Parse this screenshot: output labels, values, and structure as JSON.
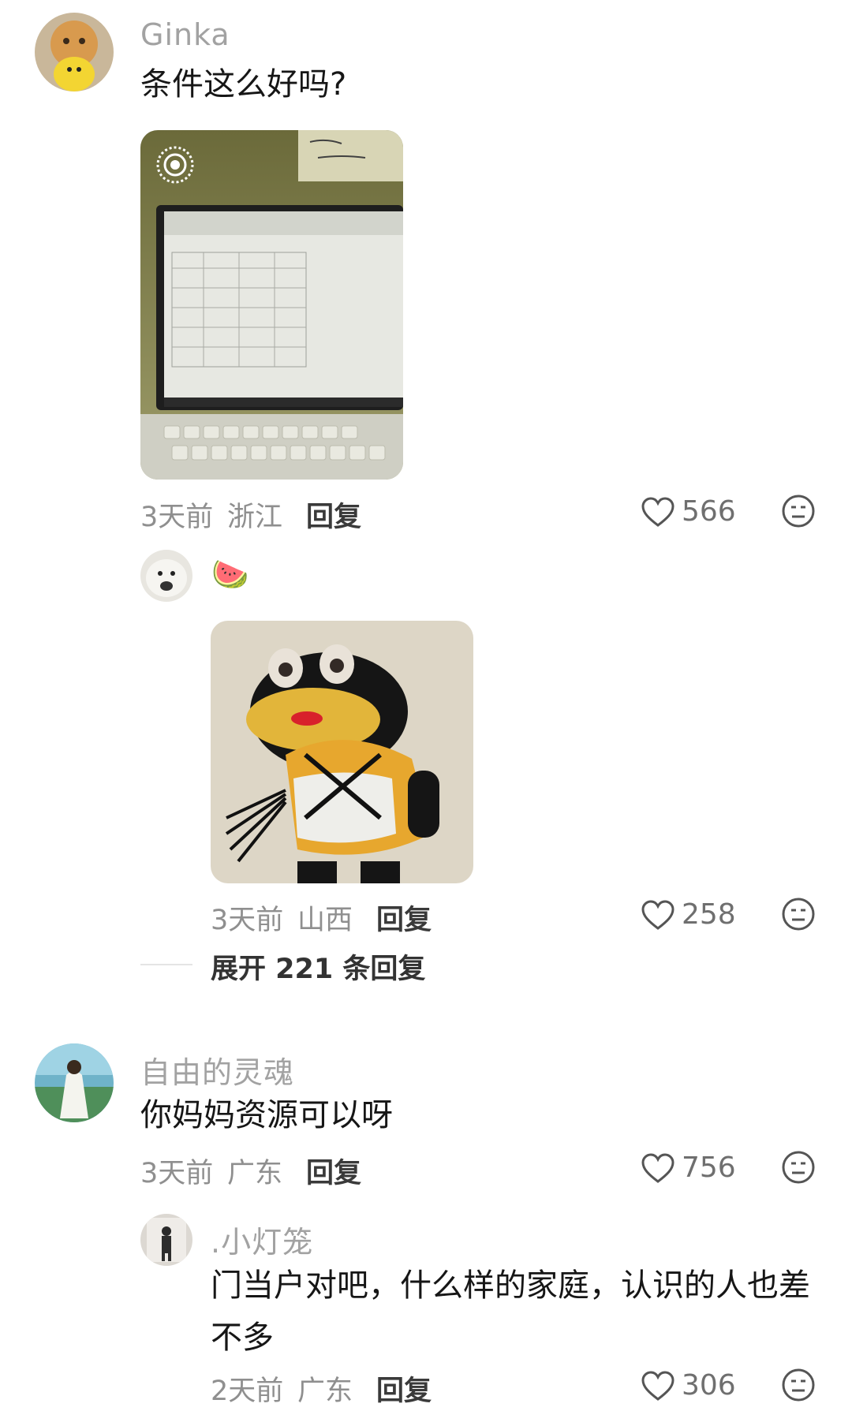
{
  "comments": [
    {
      "username": "Ginka",
      "text": "条件这么好吗?",
      "time": "3天前",
      "location": "浙江",
      "reply_label": "回复",
      "likes": "566",
      "image": "laptop-spreadsheet-photo",
      "sub_replies": [
        {
          "emoji": "🍉",
          "image": "duck-costume-meme",
          "time": "3天前",
          "location": "山西",
          "reply_label": "回复",
          "likes": "258"
        }
      ],
      "expand_label": "展开 221 条回复"
    },
    {
      "username": "自由的灵魂",
      "text": "你妈妈资源可以呀",
      "time": "3天前",
      "location": "广东",
      "reply_label": "回复",
      "likes": "756",
      "sub_replies": [
        {
          "username": ".小灯笼",
          "text": "门当户对吧，什么样的家庭，认识的人也差不多",
          "time": "2天前",
          "location": "广东",
          "reply_label": "回复",
          "likes": "306"
        }
      ]
    }
  ],
  "icons": {
    "like": "heart-outline-icon",
    "react": "neutral-face-icon"
  },
  "colors": {
    "name": "#a2a2a2",
    "meta": "#8f8f8f",
    "text": "#161616"
  }
}
